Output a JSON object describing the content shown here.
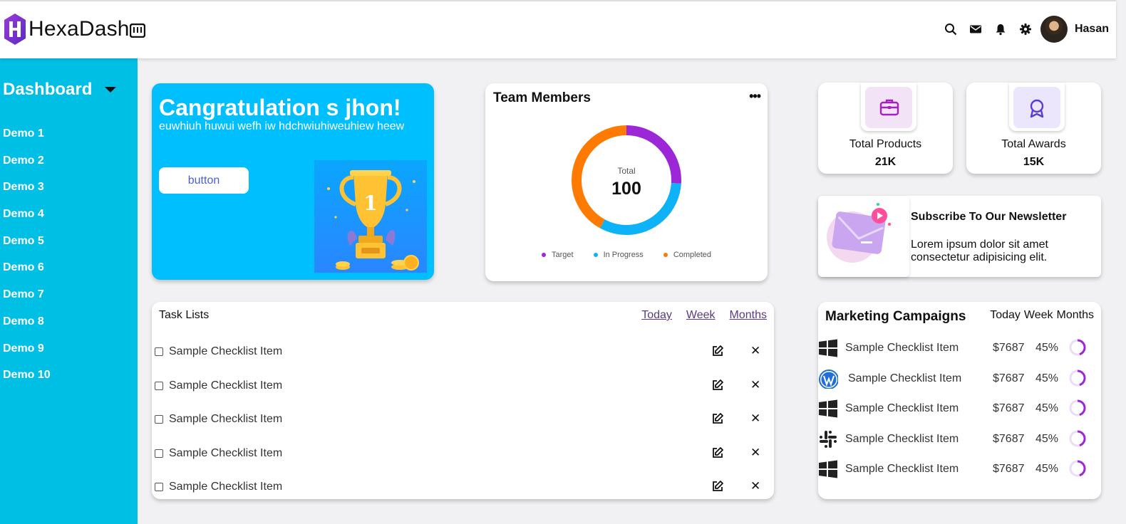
{
  "header": {
    "brand": "HexaDash",
    "user_name": "Hasan",
    "icons": [
      "search-icon",
      "mail-icon",
      "bell-icon",
      "gear-icon"
    ]
  },
  "sidebar": {
    "title": "Dashboard",
    "items": [
      "Demo 1",
      "Demo 2",
      "Demo 3",
      "Demo 4",
      "Demo 5",
      "Demo 6",
      "Demo 7",
      "Demo 8",
      "Demo 9",
      "Demo 10"
    ]
  },
  "congrats": {
    "title": "Cangratulation s jhon!",
    "subtitle": "euwhiuh huwui wefh iw hdchwiuhiweuhiew heew",
    "button_label": "button"
  },
  "team": {
    "title": "Team Members",
    "center_label": "Total",
    "center_value": "100",
    "legend": [
      {
        "label": "Target",
        "color": "#9b27d6"
      },
      {
        "label": "In Progress",
        "color": "#0eb2f6"
      },
      {
        "label": "Completed",
        "color": "#ff7a00"
      }
    ],
    "segments": [
      {
        "name": "Target",
        "fraction": 0.26,
        "color": "#9b27d6"
      },
      {
        "name": "In Progress",
        "fraction": 0.32,
        "color": "#0eb2f6"
      },
      {
        "name": "Completed",
        "fraction": 0.42,
        "color": "#ff7a00"
      }
    ]
  },
  "stats": [
    {
      "label": "Total Products",
      "value": "21K",
      "icon": "briefcase-icon",
      "tint": "#f3e3f6",
      "icon_color": "#a51fc4"
    },
    {
      "label": "Total Awards",
      "value": "15K",
      "icon": "award-icon",
      "tint": "#ebe6fb",
      "icon_color": "#5a3bd6"
    }
  ],
  "newsletter": {
    "title": "Subscribe To Our Newsletter",
    "body": "Lorem ipsum dolor sit amet consectetur adipisicing elit."
  },
  "tasks": {
    "title": "Task Lists",
    "tabs": [
      "Today",
      "Week",
      "Months"
    ],
    "items": [
      "Sample Checklist Item",
      "Sample Checklist Item",
      "Sample Checklist Item",
      "Sample Checklist Item",
      "Sample Checklist Item"
    ]
  },
  "marketing": {
    "title": "Marketing Campaigns",
    "tabs": [
      "Today",
      "Week",
      "Months"
    ],
    "rows": [
      {
        "label": "Sample Checklist Item",
        "price": "$7687",
        "percent": "45%",
        "icon": "windows-icon"
      },
      {
        "label": "Sample Checklist Item",
        "price": "$7687",
        "percent": "45%",
        "icon": "wordpress-icon"
      },
      {
        "label": "Sample Checklist Item",
        "price": "$7687",
        "percent": "45%",
        "icon": "windows-icon"
      },
      {
        "label": "Sample Checklist Item",
        "price": "$7687",
        "percent": "45%",
        "icon": "slack-icon"
      },
      {
        "label": "Sample Checklist Item",
        "price": "$7687",
        "percent": "45%",
        "icon": "windows-icon"
      }
    ]
  }
}
